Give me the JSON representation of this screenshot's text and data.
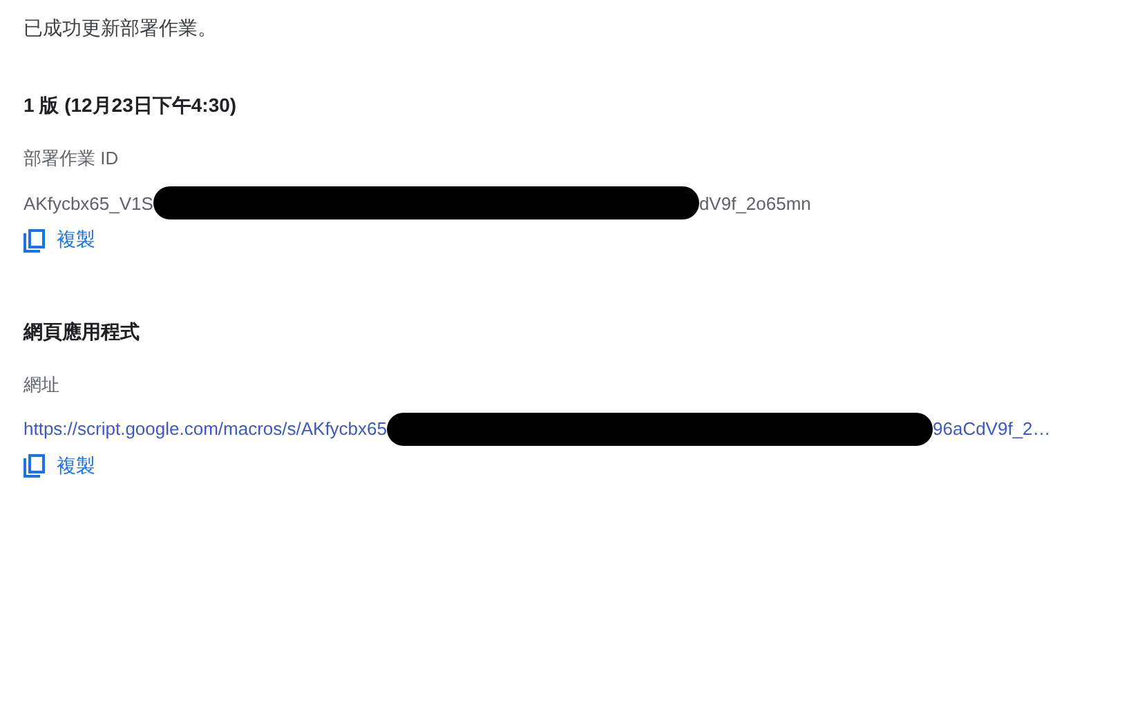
{
  "message": "已成功更新部署作業。",
  "sections": [
    {
      "heading": "1 版 (12月23日下午4:30)",
      "field_label": "部署作業 ID",
      "kind": "text",
      "value_start": "AKfycbx65_V1S",
      "value_end": "dV9f_2o65mn",
      "copy_label": "複製"
    },
    {
      "heading": "網頁應用程式",
      "field_label": "網址",
      "kind": "link",
      "value_start": "https://script.google.com/macros/s/AKfycbx65",
      "value_end": "96aCdV9f_2…",
      "copy_label": "複製"
    }
  ]
}
